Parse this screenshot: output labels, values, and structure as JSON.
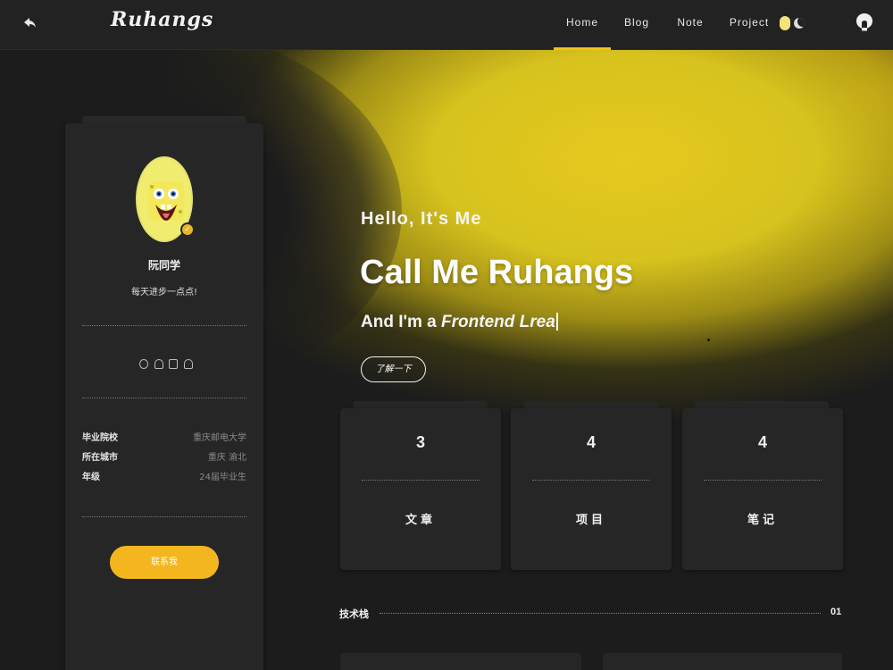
{
  "header": {
    "logo": "Ruhangs",
    "nav": [
      {
        "label": "Home",
        "active": true
      },
      {
        "label": "Blog",
        "active": false
      },
      {
        "label": "Note",
        "active": false
      },
      {
        "label": "Project",
        "active": false
      }
    ],
    "accent_color": "#f1c21b"
  },
  "profile": {
    "name": "阮同学",
    "motto": "每天进步一点点!",
    "social_icons": [
      "wechat-icon",
      "github-icon",
      "mail-icon",
      "qq-icon"
    ],
    "info": [
      {
        "label": "毕业院校",
        "value": "重庆邮电大学"
      },
      {
        "label": "所在城市",
        "value": "重庆 渝北"
      },
      {
        "label": "年级",
        "value": "24届毕业生"
      }
    ],
    "contact_button": "联系我"
  },
  "hero": {
    "greeting": "Hello, It's Me",
    "name": "Call Me Ruhangs",
    "role_prefix": "And I'm a ",
    "role_typed": "Frontend Lrea",
    "button": "了解一下"
  },
  "stats": [
    {
      "value": "3",
      "label": "文章"
    },
    {
      "value": "4",
      "label": "项目"
    },
    {
      "value": "4",
      "label": "笔记"
    }
  ],
  "tech": {
    "title": "技术栈",
    "index": "01"
  }
}
